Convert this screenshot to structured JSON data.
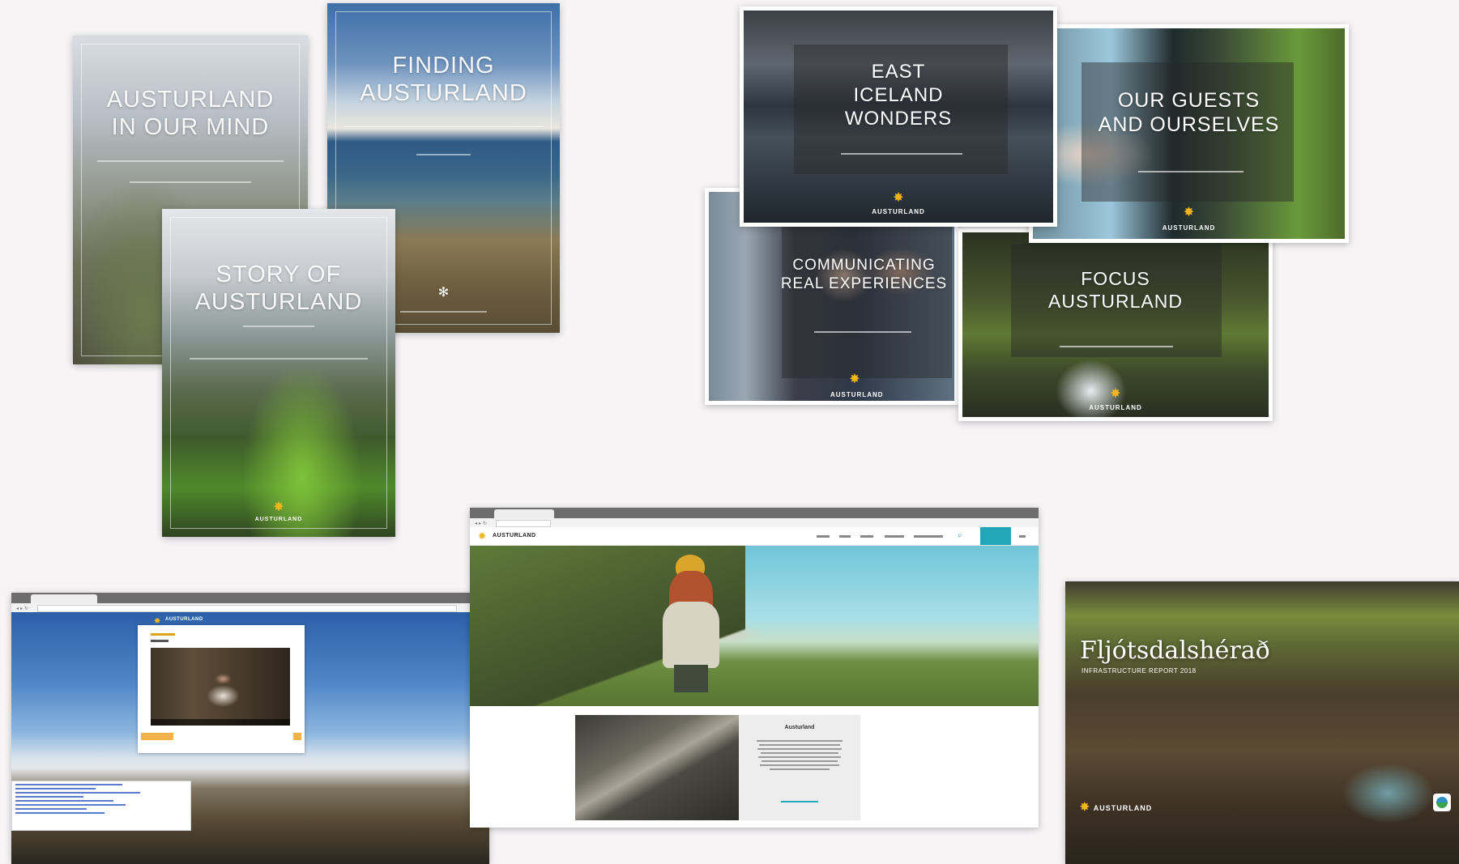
{
  "covers": {
    "austurland_mind": {
      "title": "AUSTURLAND\nIN OUR MIND"
    },
    "finding": {
      "title": "FINDING\nAUSTURLAND"
    },
    "story": {
      "title": "STORY OF\nAUSTURLAND",
      "brand": "AUSTURLAND"
    }
  },
  "slides": {
    "east": {
      "title": "EAST\nICELAND\nWONDERS",
      "brand": "AUSTURLAND"
    },
    "guests": {
      "title": "OUR GUESTS\nAND OURSELVES",
      "brand": "AUSTURLAND"
    },
    "comm": {
      "title": "COMMUNICATING\nREAL EXPERIENCES",
      "brand": "AUSTURLAND"
    },
    "focus": {
      "title": "FOCUS\nAUSTURLAND",
      "brand": "AUSTURLAND"
    }
  },
  "website": {
    "logo": "AUSTURLAND",
    "feature_title": "Austurland"
  },
  "video_site": {
    "logo": "AUSTURLAND"
  },
  "report": {
    "title": "Fljótsdalshérað",
    "subtitle": "INFRASTRUCTURE REPORT 2018",
    "brand": "AUSTURLAND"
  },
  "colors": {
    "accent": "#22a7b9",
    "brand_star": "#f2b51c",
    "background": "#f6f4f5"
  }
}
